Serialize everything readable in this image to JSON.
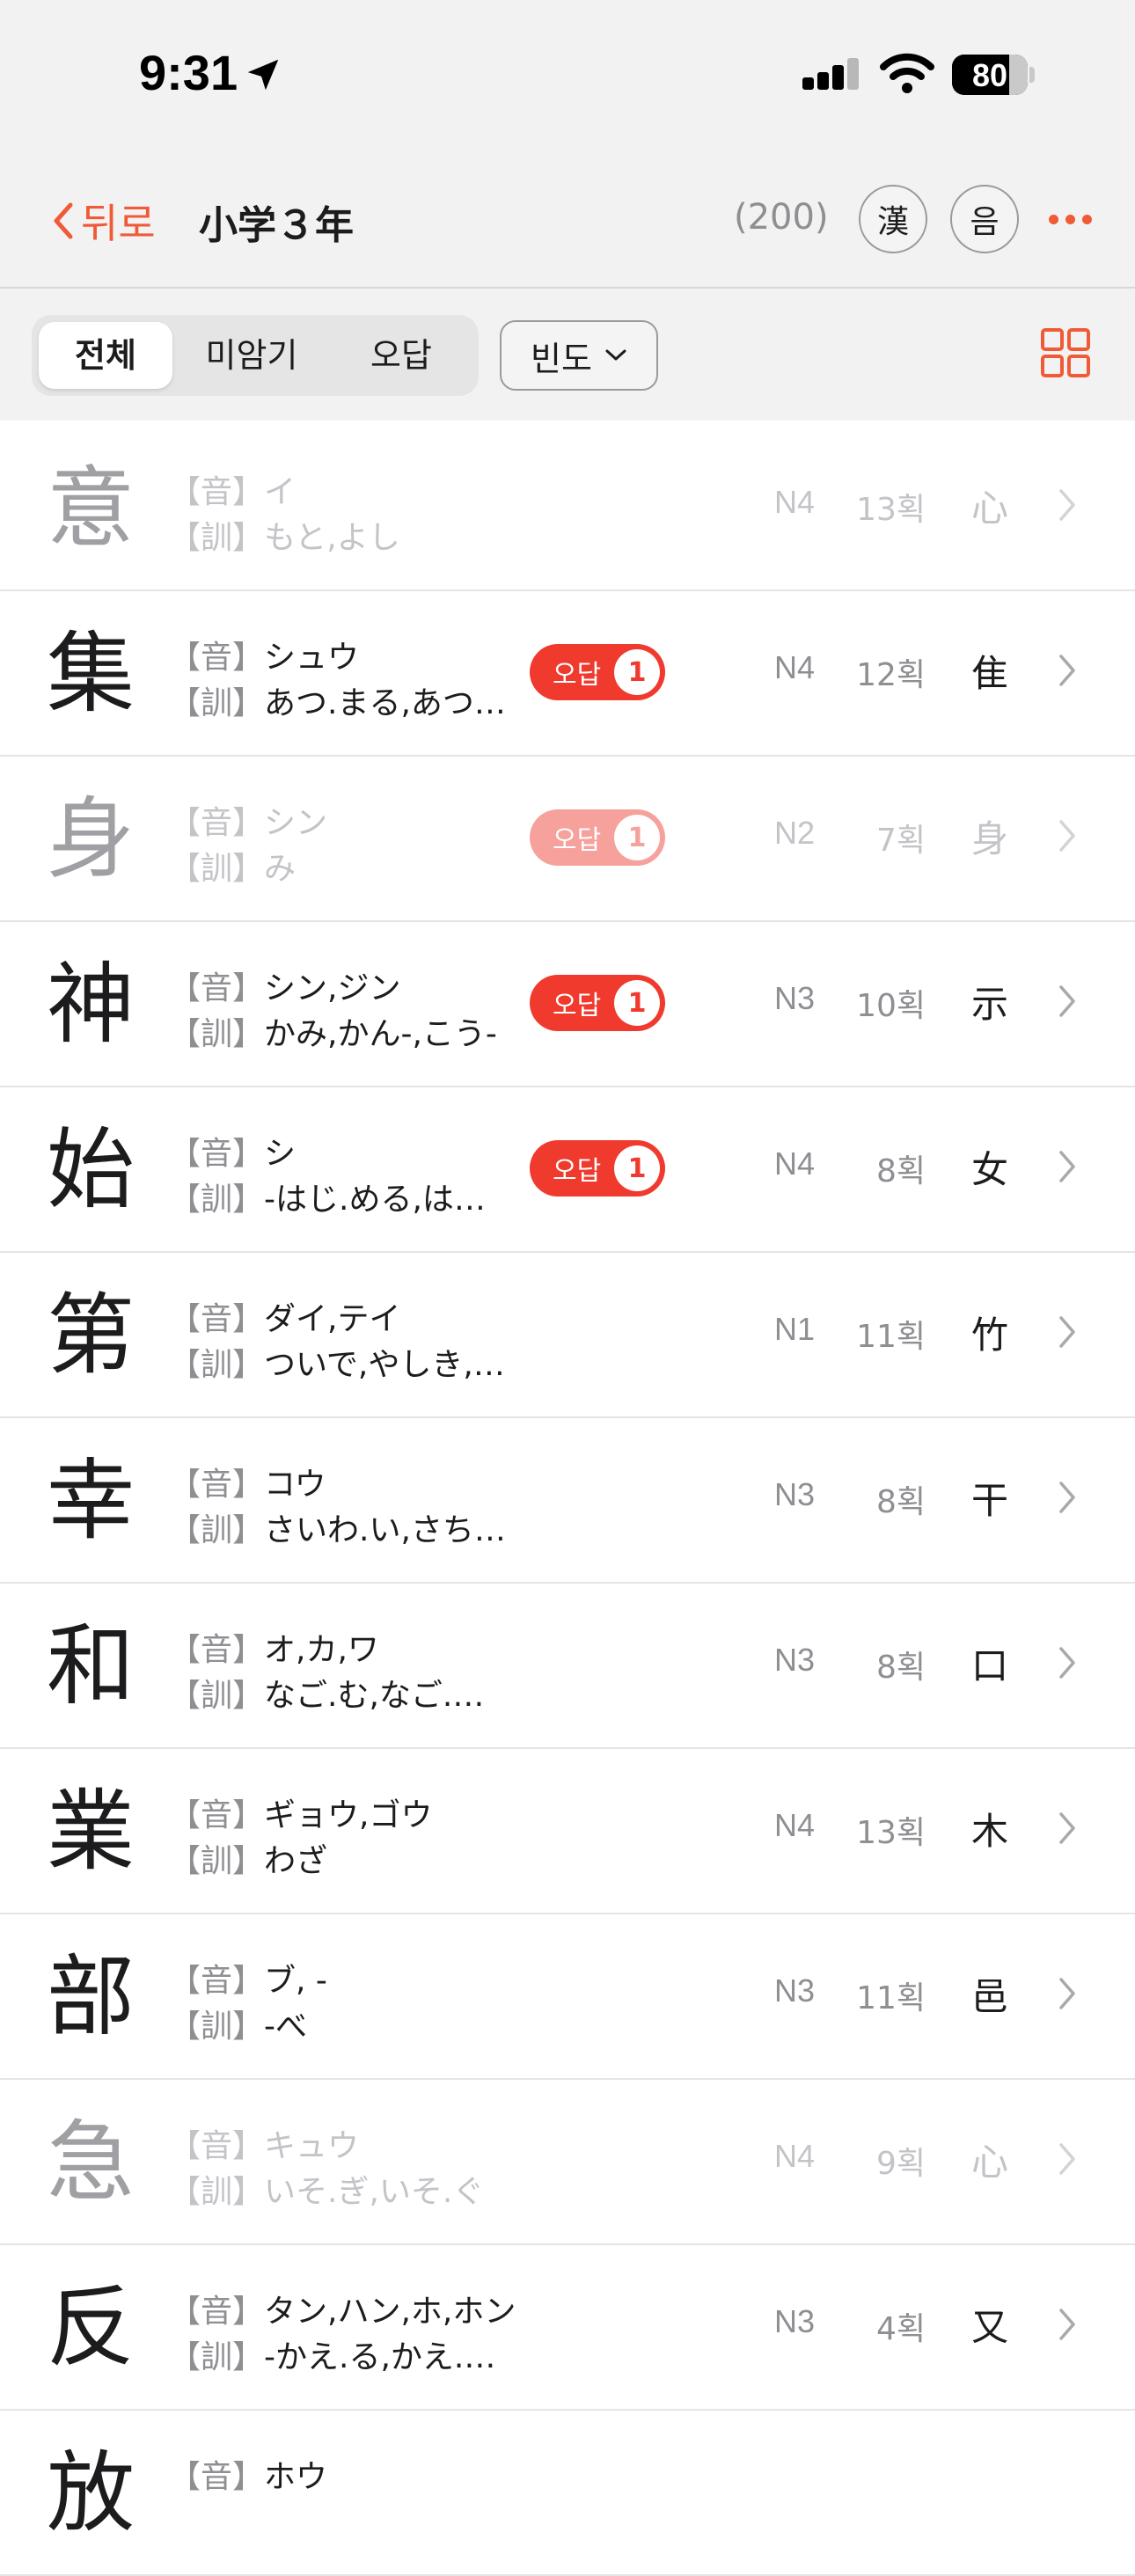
{
  "status": {
    "time": "9:31",
    "battery": "80"
  },
  "nav": {
    "back_label": "뒤로",
    "title": "小学３年",
    "count": "(200)",
    "btn_kanji": "漢",
    "btn_sound": "음"
  },
  "filter": {
    "tabs": [
      "전체",
      "미암기",
      "오답"
    ],
    "sort_label": "빈도"
  },
  "labels": {
    "on": "【音】",
    "kun": "【訓】",
    "wrong": "오답"
  },
  "colors": {
    "accent": "#f05a36",
    "badge": "#f03a2e",
    "badge_dim": "#f7a19c"
  },
  "rows": [
    {
      "kanji": "意",
      "on": "イ",
      "kun": "もと,よし",
      "level": "N4",
      "strokes": "13획",
      "radical": "心",
      "dim": true,
      "wrong": null
    },
    {
      "kanji": "集",
      "on": "シュウ",
      "kun": "あつ.まる,あつ.…",
      "level": "N4",
      "strokes": "12획",
      "radical": "隹",
      "dim": false,
      "wrong": "1"
    },
    {
      "kanji": "身",
      "on": "シン",
      "kun": "み",
      "level": "N2",
      "strokes": "7획",
      "radical": "身",
      "dim": true,
      "wrong": "1"
    },
    {
      "kanji": "神",
      "on": "シン,ジン",
      "kun": "かみ,かん-,こう-",
      "level": "N3",
      "strokes": "10획",
      "radical": "示",
      "dim": false,
      "wrong": "1"
    },
    {
      "kanji": "始",
      "on": "シ",
      "kun": "-はじ.める,はじ…",
      "level": "N4",
      "strokes": "8획",
      "radical": "女",
      "dim": false,
      "wrong": "1"
    },
    {
      "kanji": "第",
      "on": "ダイ,テイ",
      "kun": "ついで,やしき,ただ",
      "level": "N1",
      "strokes": "11획",
      "radical": "竹",
      "dim": false,
      "wrong": null
    },
    {
      "kanji": "幸",
      "on": "コウ",
      "kun": "さいわ.い,さち,しあわ.せ",
      "level": "N3",
      "strokes": "8획",
      "radical": "干",
      "dim": false,
      "wrong": null
    },
    {
      "kanji": "和",
      "on": "オ,カ,ワ",
      "kun": "なご.む,なご.やか,やわ.ら…",
      "level": "N3",
      "strokes": "8획",
      "radical": "口",
      "dim": false,
      "wrong": null
    },
    {
      "kanji": "業",
      "on": "ギョウ,ゴウ",
      "kun": "わざ",
      "level": "N4",
      "strokes": "13획",
      "radical": "木",
      "dim": false,
      "wrong": null
    },
    {
      "kanji": "部",
      "on": "ブ, -",
      "kun": "-べ",
      "level": "N3",
      "strokes": "11획",
      "radical": "邑",
      "dim": false,
      "wrong": null
    },
    {
      "kanji": "急",
      "on": "キュウ",
      "kun": "いそ.ぎ,いそ.ぐ",
      "level": "N4",
      "strokes": "9획",
      "radical": "心",
      "dim": true,
      "wrong": null
    },
    {
      "kanji": "反",
      "on": "タン,ハン,ホ,ホン",
      "kun": "-かえ.る,かえ.す,かえ.る,…",
      "level": "N3",
      "strokes": "4획",
      "radical": "又",
      "dim": false,
      "wrong": null
    },
    {
      "kanji": "放",
      "on": "ホウ",
      "kun": "",
      "level": "",
      "strokes": "",
      "radical": "",
      "dim": false,
      "wrong": null
    }
  ]
}
